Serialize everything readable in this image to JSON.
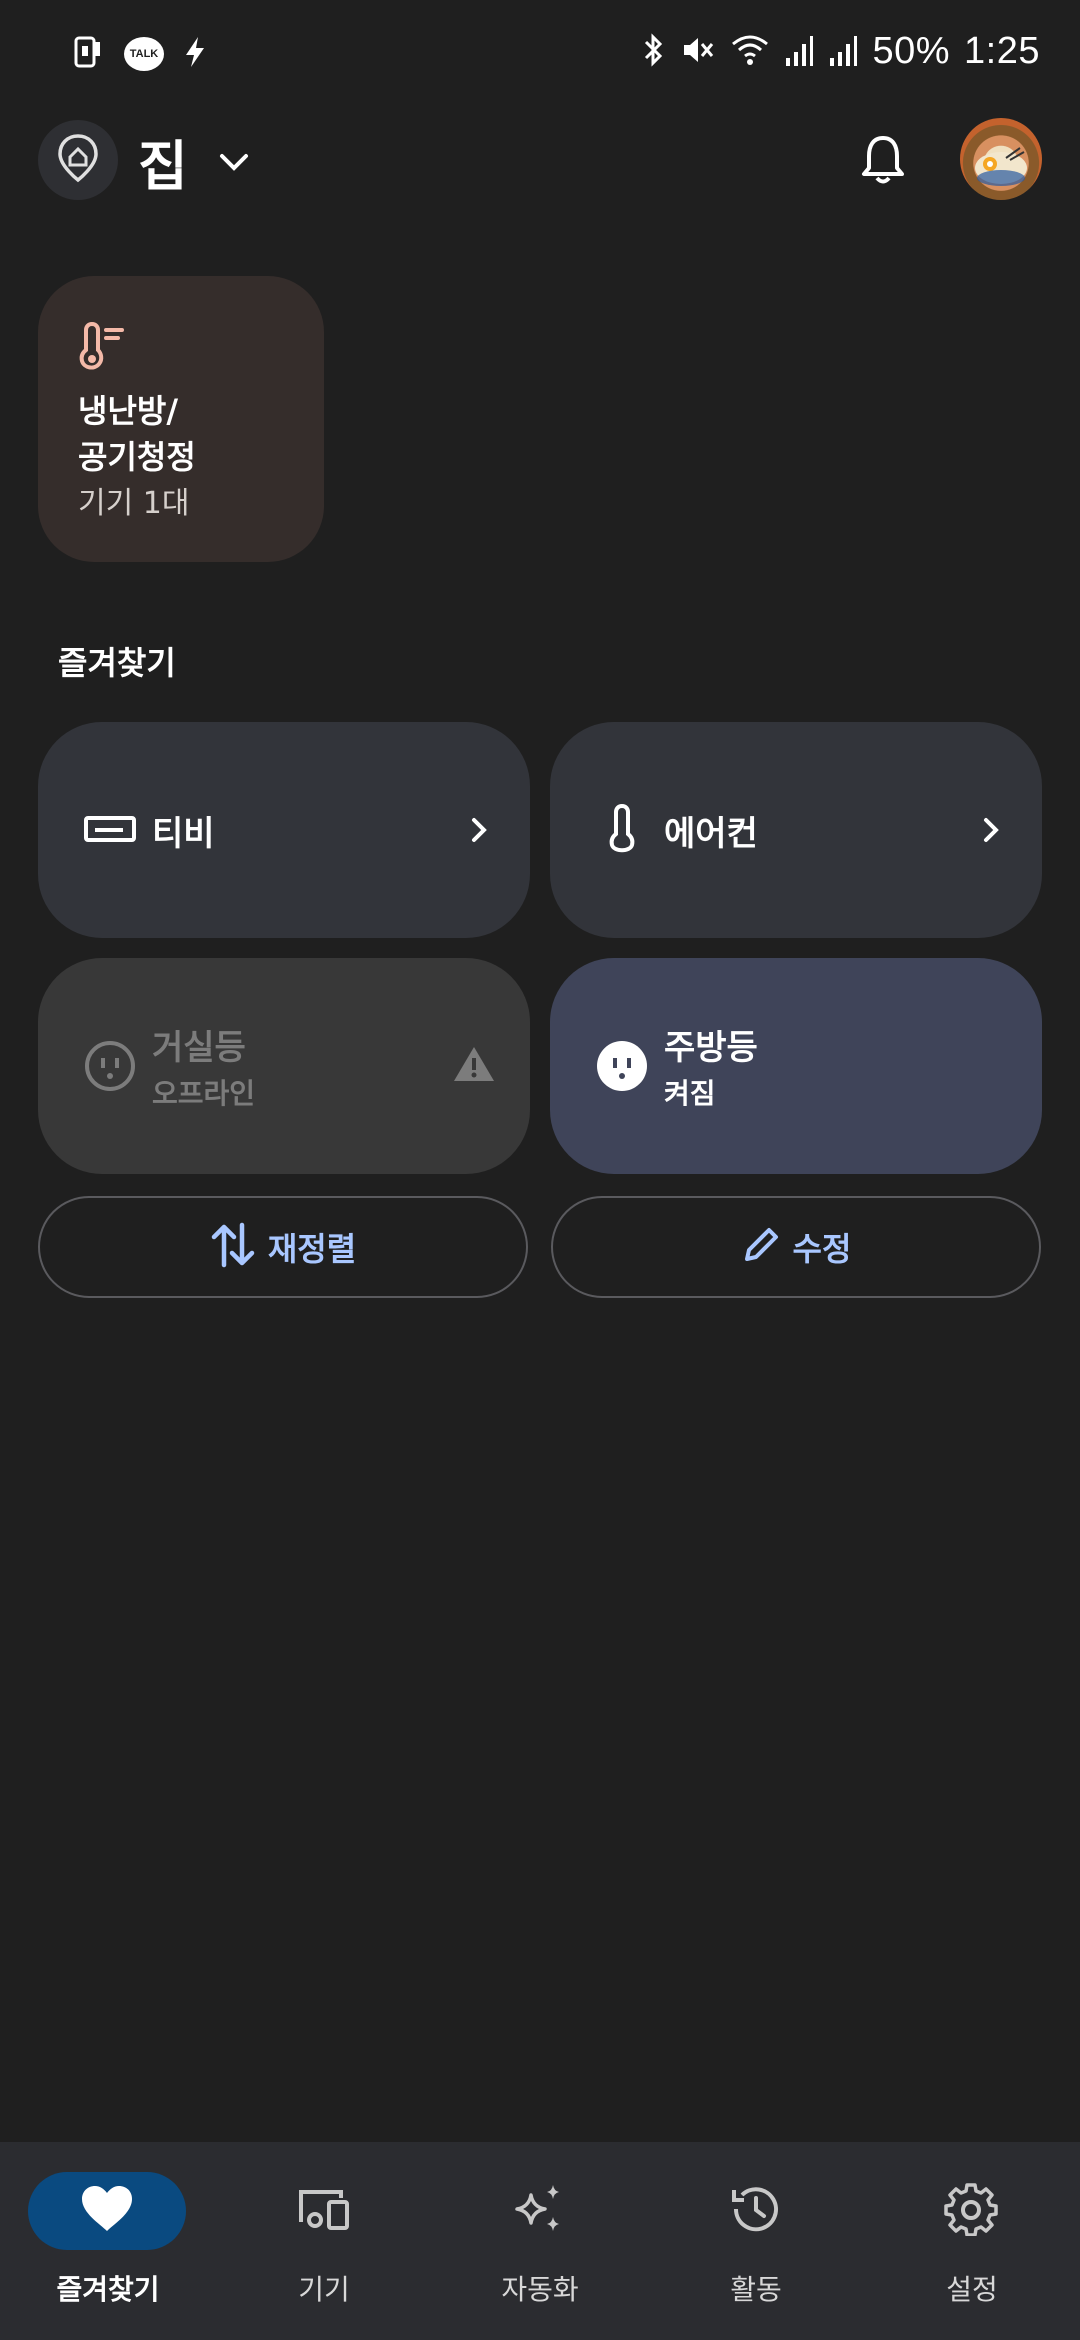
{
  "status_bar": {
    "battery": "50%",
    "time": "1:25",
    "talk_badge": "TALK",
    "icons": [
      "phone-alert-icon",
      "kakaotalk-icon",
      "charging-icon",
      "bluetooth-icon",
      "mute-icon",
      "wifi-icon",
      "signal-icon",
      "signal-icon"
    ]
  },
  "header": {
    "location": "집",
    "icons": [
      "home-location-icon",
      "chevron-down-icon",
      "bell-icon",
      "avatar"
    ]
  },
  "category": {
    "title_line1": "냉난방/",
    "title_line2": "공기청정",
    "subtitle": "기기 1대",
    "icon": "thermostat-icon",
    "accent": "#f4b9a8"
  },
  "favorites": {
    "title": "즐겨찾기",
    "devices": [
      {
        "name": "티비",
        "icon": "tv-icon"
      },
      {
        "name": "에어컨",
        "icon": "thermometer-icon"
      },
      {
        "name": "거실등",
        "status": "오프라인",
        "icon": "plug-icon"
      },
      {
        "name": "주방등",
        "status": "켜짐",
        "icon": "plug-icon"
      }
    ],
    "reorder_label": "재정렬",
    "edit_label": "수정"
  },
  "nav": {
    "items": [
      {
        "label": "즐겨찾기",
        "icon": "heart-icon",
        "active": true
      },
      {
        "label": "기기",
        "icon": "devices-icon"
      },
      {
        "label": "자동화",
        "icon": "sparkle-icon"
      },
      {
        "label": "활동",
        "icon": "history-icon"
      },
      {
        "label": "설정",
        "icon": "gear-icon"
      }
    ]
  },
  "colors": {
    "background": "#1f1f1f",
    "tile": "#32343a",
    "tile_on": "#3f4459",
    "accent_text": "#a9c7ff",
    "nav_active": "#0a4a80"
  }
}
